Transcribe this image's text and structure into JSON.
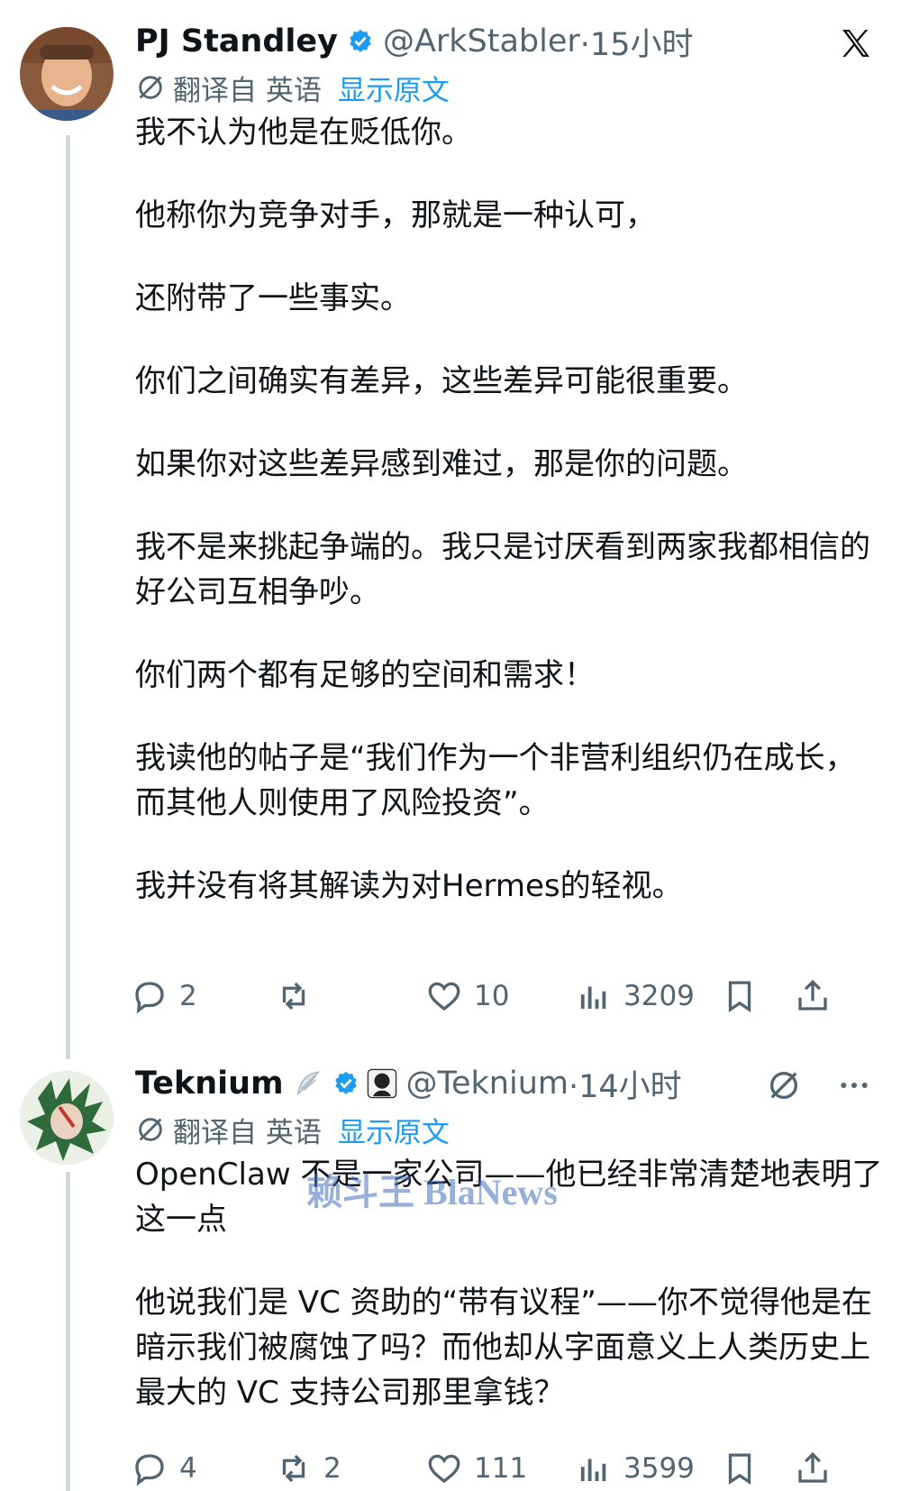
{
  "post1": {
    "name": "PJ Standley",
    "handle": "@ArkStabler",
    "time": "·15小时",
    "translated_from": "翻译自 英语",
    "show_original": "显示原文",
    "paragraphs": [
      "我不认为他是在贬低你。",
      "他称你为竞争对手，那就是一种认可，",
      "还附带了一些事实。",
      "你们之间确实有差异，这些差异可能很重要。",
      "如果你对这些差异感到难过，那是你的问题。",
      "我不是来挑起争端的。我只是讨厌看到两家我都相信的好公司互相争吵。",
      "你们两个都有足够的空间和需求！",
      "我读他的帖子是“我们作为一个非营利组织仍在成长，而其他人则使用了风险投资”。",
      "我并没有将其解读为对Hermes的轻视。"
    ],
    "replies": "2",
    "retweets": "",
    "likes": "10",
    "views": "3209"
  },
  "post2": {
    "name": "Teknium",
    "handle": "@Teknium",
    "time": "·14小时",
    "translated_from": "翻译自 英语",
    "show_original": "显示原文",
    "paragraphs": [
      "OpenClaw 不是一家公司——他已经非常清楚地表明了这一点",
      "他说我们是 VC 资助的“带有议程”——你不觉得他是在暗示我们被腐蚀了吗？而他却从字面意义上人类历史上最大的 VC 支持公司那里拿钱？"
    ],
    "replies": "4",
    "retweets": "2",
    "likes": "111",
    "views": "3599"
  },
  "watermark": "赖斗王 BlaNews",
  "colors": {
    "text": "#0f1419",
    "muted": "#536471",
    "link": "#1d9bf0",
    "verified": "#1d9bf0",
    "thread": "#cfd9de"
  },
  "icons": [
    "x-logo-icon",
    "verified-badge-icon",
    "translate-icon",
    "reply-icon",
    "retweet-icon",
    "like-icon",
    "views-icon",
    "bookmark-icon",
    "share-icon",
    "grok-icon",
    "more-icon"
  ]
}
